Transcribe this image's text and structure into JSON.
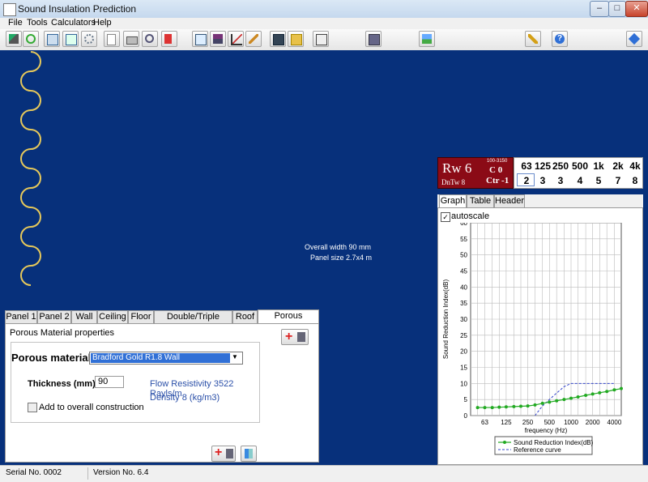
{
  "window": {
    "title": "Sound Insulation Prediction"
  },
  "menu": [
    "File",
    "Tools",
    "Calculators",
    "Help"
  ],
  "toolbar_icons": [
    "pointer-icon",
    "refresh-icon",
    "graph1-icon",
    "graph2-icon",
    "settings-icon",
    "new-doc-icon",
    "print-icon",
    "preview-icon",
    "pdf-icon",
    "copy-icon",
    "layers-icon",
    "chart-icon",
    "edit-icon",
    "save-icon",
    "open-icon",
    "box-icon",
    "calculator-icon",
    "picture-icon",
    "key-icon",
    "help-icon",
    "info-icon"
  ],
  "canvas": {
    "overall_width": "Overall width 90 mm",
    "panel_size": "Panel size 2.7x4 m"
  },
  "rating": {
    "rw": "Rw 6",
    "c": "C 0",
    "ctr": "Ctr -1",
    "range": "100-3150",
    "dntw": "DnTw 8"
  },
  "octave": {
    "freqs": [
      "63",
      "125",
      "250",
      "500",
      "1k",
      "2k",
      "4k"
    ],
    "values": [
      "2",
      "3",
      "3",
      "4",
      "5",
      "7",
      "8"
    ]
  },
  "graph_tabs": [
    "Graph",
    "Table",
    "Header"
  ],
  "graph": {
    "autoscale_label": "autoscale",
    "autoscale_checked": true
  },
  "chart_data": {
    "type": "line",
    "xlabel": "frequency (Hz)",
    "ylabel": "Sound Reduction Index(dB)",
    "ylim": [
      0,
      60
    ],
    "yticks": [
      0,
      5,
      10,
      15,
      20,
      25,
      30,
      35,
      40,
      45,
      50,
      55,
      60
    ],
    "xtick_labels": [
      "63",
      "125",
      "250",
      "500",
      "1000",
      "2000",
      "4000"
    ],
    "x": [
      50,
      63,
      80,
      100,
      125,
      160,
      200,
      250,
      315,
      400,
      500,
      630,
      800,
      1000,
      1250,
      1600,
      2000,
      2500,
      3150,
      4000,
      5000
    ],
    "series": [
      {
        "name": "Sound Reduction Index(dB)",
        "color": "#22aa22",
        "values": [
          2.5,
          2.5,
          2.5,
          2.6,
          2.7,
          2.8,
          2.9,
          3.0,
          3.3,
          3.8,
          4.2,
          4.6,
          5.0,
          5.4,
          5.8,
          6.3,
          6.7,
          7.1,
          7.5,
          8.0,
          8.4
        ]
      },
      {
        "name": "Reference curve",
        "color": "#3344cc",
        "dashed": true,
        "x": [
          315,
          400,
          500,
          630,
          800,
          1000,
          1250,
          1600,
          2000,
          2500,
          3150,
          4000
        ],
        "values": [
          0,
          3,
          5,
          7,
          9,
          10,
          10,
          10,
          10,
          10,
          10,
          10
        ]
      }
    ],
    "legend": "bottom"
  },
  "panel_tabs": [
    "Panel 1",
    "Panel 2",
    "Wall",
    "Ceiling",
    "Floor",
    "Double/Triple Glazing",
    "Roof",
    "Porous Material"
  ],
  "porous": {
    "section_title": "Porous Material properties",
    "material_label": "Porous material",
    "material_value": "Bradford Gold R1.8 Wall",
    "thickness_label": "Thickness (mm)",
    "thickness_value": "90",
    "flow_resistivity": "Flow Resistivity  3522 Rayls/m",
    "density": "Density  8 (kg/m3)",
    "add_label": "Add to overall construction"
  },
  "status": {
    "serial": "Serial No. 0002",
    "version": "Version No. 6.4"
  }
}
